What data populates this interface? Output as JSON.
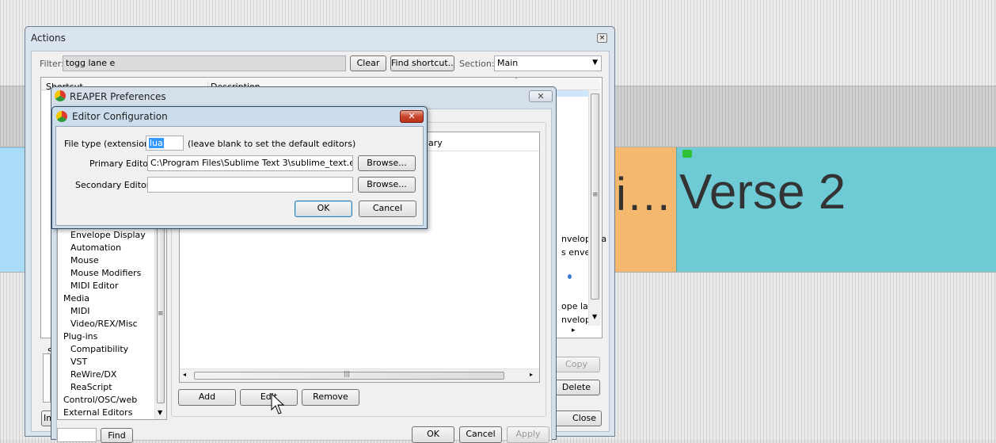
{
  "arrange": {
    "region_partial_label": "i…",
    "region_label": "Verse 2",
    "colors": {
      "region_cyan": "#6ecbd6",
      "region_orange": "#f4b86e",
      "region_lightblue": "#a8dcf7"
    }
  },
  "actions": {
    "title": "Actions",
    "filter_label": "Filter:",
    "filter_value": "togg lane e",
    "clear_label": "Clear",
    "find_shortcut_label": "Find shortcut...",
    "section_label": "Section:",
    "section_value": "Main",
    "col_shortcut": "Shortcut",
    "col_description": "Description",
    "right_fragments": [
      "nvelope la",
      "s envelo",
      "ope lane",
      "nvelope"
    ],
    "copy_label": "Copy",
    "delete_label": "Delete",
    "close_label": "Close",
    "im_fragment": "Im",
    "s_fragment": "S"
  },
  "prefs": {
    "title": "REAPER Preferences",
    "col_fragment": "ndary",
    "tree": [
      {
        "label": "Envelope Display",
        "indent": 1
      },
      {
        "label": "Automation",
        "indent": 1
      },
      {
        "label": "Mouse",
        "indent": 1
      },
      {
        "label": "Mouse Modifiers",
        "indent": 1
      },
      {
        "label": "MIDI Editor",
        "indent": 1
      },
      {
        "label": "Media",
        "indent": 0
      },
      {
        "label": "MIDI",
        "indent": 1
      },
      {
        "label": "Video/REX/Misc",
        "indent": 1
      },
      {
        "label": "Plug-ins",
        "indent": 0
      },
      {
        "label": "Compatibility",
        "indent": 1
      },
      {
        "label": "VST",
        "indent": 1
      },
      {
        "label": "ReWire/DX",
        "indent": 1
      },
      {
        "label": "ReaScript",
        "indent": 1
      },
      {
        "label": "Control/OSC/web",
        "indent": 0
      },
      {
        "label": "External Editors",
        "indent": 0
      }
    ],
    "add_label": "Add",
    "edit_label": "Edit",
    "remove_label": "Remove",
    "find_label": "Find",
    "ok_label": "OK",
    "cancel_label": "Cancel",
    "apply_label": "Apply"
  },
  "editor": {
    "title": "Editor Configuration",
    "file_type_label": "File type (extension):",
    "file_type_value": "lua",
    "hint": "(leave blank to set the default editors)",
    "primary_label": "Primary Editor:",
    "primary_value": "C:\\Program Files\\Sublime Text 3\\sublime_text.exe",
    "secondary_label": "Secondary Editor:",
    "secondary_value": "",
    "browse_label": "Browse...",
    "ok_label": "OK",
    "cancel_label": "Cancel"
  }
}
